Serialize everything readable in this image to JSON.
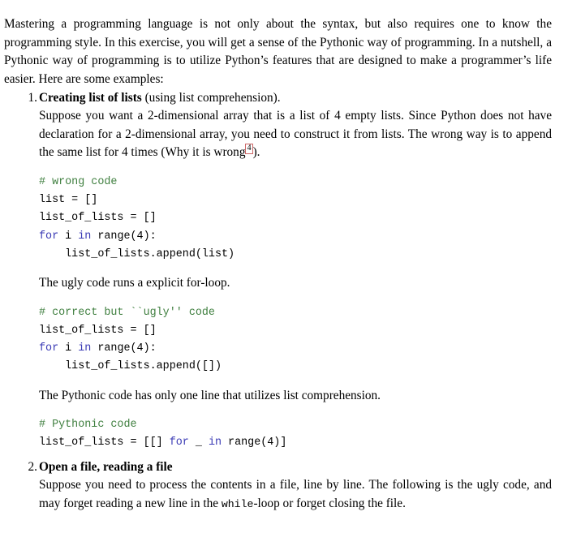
{
  "document": {
    "intro_paragraph": "Mastering a programming language is not only about the syntax, but also requires one to know the programming style. In this exercise, you will get a sense of the Pythonic way of programming. In a nutshell, a Pythonic way of programming is to utilize Python’s features that are designed to make a programmer’s life easier. Here are some examples:",
    "accent_colors": {
      "comment_green": "#3f7f3f",
      "keyword_blue": "#3b3bb5",
      "footnote_link_border": "#cc6666",
      "text_black": "#000000",
      "page_background": "#ffffff"
    },
    "items": [
      {
        "number": "1.",
        "title": "Creating list of lists",
        "title_suffix": " (using list comprehension).",
        "body_before_footnote": "Suppose you want a 2-dimensional array that is a list of 4 empty lists. Since Python does not have declaration for a 2-dimensional array, you need to construct it from lists. The wrong way is to append the same list for 4 times (Why it is wrong",
        "footnote_marker": "4",
        "body_after_footnote": ").",
        "code_block_1": [
          {
            "text": "# wrong code",
            "style": "comment"
          },
          {
            "text": "list = []",
            "style": "plain"
          },
          {
            "text": "list_of_lists = []",
            "style": "plain"
          },
          {
            "text": "for i in range(4):",
            "style": "keyword-for-in"
          },
          {
            "text": "    list_of_lists.append(list)",
            "style": "plain"
          }
        ],
        "paragraph_2": "The ugly code runs a explicit for-loop.",
        "code_block_2": [
          {
            "text": "# correct but ``ugly'' code",
            "style": "comment"
          },
          {
            "text": "list_of_lists = []",
            "style": "plain"
          },
          {
            "text": "for i in range(4):",
            "style": "keyword-for-in"
          },
          {
            "text": "    list_of_lists.append([])",
            "style": "plain"
          }
        ],
        "paragraph_3": "The Pythonic code has only one line that utilizes list comprehension.",
        "code_block_3": [
          {
            "text": "# Pythonic code",
            "style": "comment"
          },
          {
            "text": "list_of_lists = [[] for _ in range(4)]",
            "style": "keyword-for-in"
          }
        ]
      },
      {
        "number": "2.",
        "title": "Open a file, reading a file",
        "body_part_1": "Suppose you need to process the contents in a file, line by line. The following is the ugly code, and may forget reading a new line in the ",
        "inline_code": "while",
        "body_part_2": "-loop or forget closing the file."
      }
    ],
    "code_lines": {
      "b1_l1_comment": "# wrong code",
      "b1_l2": "list = []",
      "b1_l3": "list_of_lists = []",
      "b1_l4_kw1": "for",
      "b1_l4_mid": " i ",
      "b1_l4_kw2": "in",
      "b1_l4_rest": " range(4):",
      "b1_l5": "    list_of_lists.append(list)",
      "b2_l1_comment": "# correct but ``ugly'' code",
      "b2_l2": "list_of_lists = []",
      "b2_l3_kw1": "for",
      "b2_l3_mid": " i ",
      "b2_l3_kw2": "in",
      "b2_l3_rest": " range(4):",
      "b2_l4": "    list_of_lists.append([])",
      "b3_l1_comment": "# Pythonic code",
      "b3_l2_pre": "list_of_lists = [[] ",
      "b3_l2_kw1": "for",
      "b3_l2_mid": " _ ",
      "b3_l2_kw2": "in",
      "b3_l2_rest": " range(4)]"
    }
  }
}
